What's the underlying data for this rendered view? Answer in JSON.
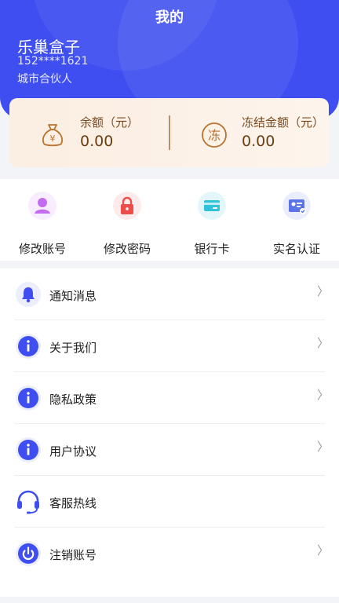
{
  "header": {
    "title": "我的",
    "user_name": "乐巢盒子",
    "phone": "152****1621",
    "role": "城市合伙人"
  },
  "balance": {
    "balance_label": "余额（元）",
    "balance_value": "0.00",
    "frozen_label": "冻结金额（元）",
    "frozen_value": "0.00",
    "frozen_icon_char": "冻",
    "balance_icon_char": "¥"
  },
  "quick_actions": [
    {
      "label": "修改账号",
      "icon": "user-icon",
      "color": "#c46cf0"
    },
    {
      "label": "修改密码",
      "icon": "lock-icon",
      "color": "#ec4c4a"
    },
    {
      "label": "银行卡",
      "icon": "bank-card-icon",
      "color": "#2fc2d8"
    },
    {
      "label": "实名认证",
      "icon": "id-card-icon",
      "color": "#5a74e8"
    }
  ],
  "menu": [
    {
      "label": "通知消息",
      "icon": "bell-icon"
    },
    {
      "label": "关于我们",
      "icon": "info-icon"
    },
    {
      "label": "隐私政策",
      "icon": "info-icon"
    },
    {
      "label": "用户协议",
      "icon": "info-icon"
    },
    {
      "label": "客服热线",
      "icon": "headset-icon"
    },
    {
      "label": "注销账号",
      "icon": "power-icon"
    }
  ],
  "colors": {
    "primary": "#3e4ef0",
    "card_text": "#6b3e12"
  }
}
